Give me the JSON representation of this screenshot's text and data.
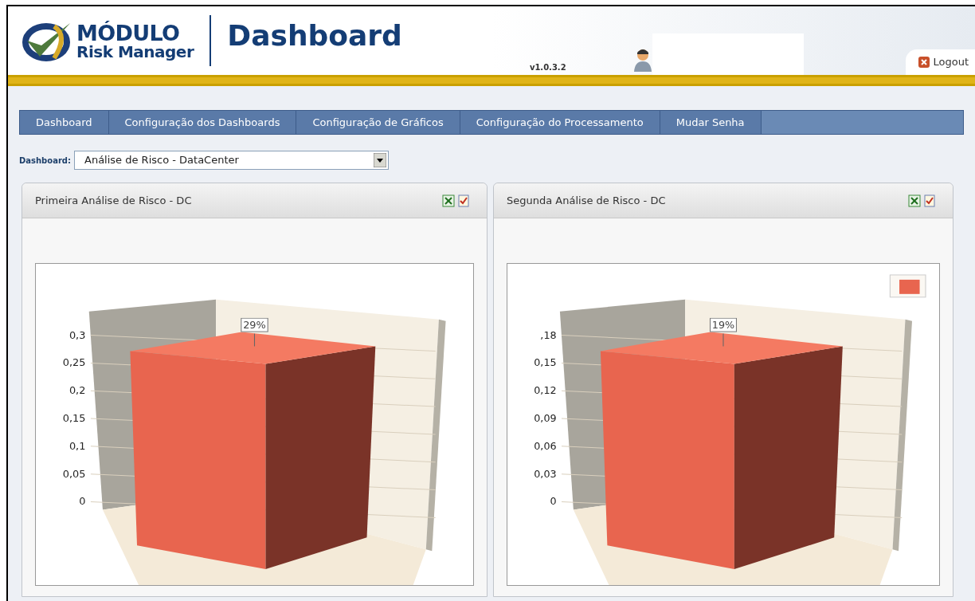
{
  "header": {
    "brand_top": "MÓDULO",
    "brand_bottom": "Risk Manager",
    "title": "Dashboard",
    "version": "v1.0.3.2",
    "logout": "Logout"
  },
  "nav": [
    {
      "label": "Dashboard"
    },
    {
      "label": "Configuração dos Dashboards"
    },
    {
      "label": "Configuração de Gráficos"
    },
    {
      "label": "Configuração do Processamento"
    },
    {
      "label": "Mudar Senha"
    }
  ],
  "selector": {
    "label": "Dashboard:",
    "value": "Análise de Risco - DataCenter"
  },
  "panels": [
    {
      "title": "Primeira Análise de Risco - DC",
      "legend": false,
      "axis_labels": [
        "0,3",
        "0,25",
        "0,2",
        "0,15",
        "0,1",
        "0,05",
        "0"
      ],
      "data_label": "29%"
    },
    {
      "title": "Segunda Análise de Risco - DC",
      "legend": true,
      "axis_labels": [
        ",18",
        "0,15",
        "0,12",
        "0,09",
        "0,06",
        "0,03",
        "0"
      ],
      "data_label": "19%"
    }
  ]
}
